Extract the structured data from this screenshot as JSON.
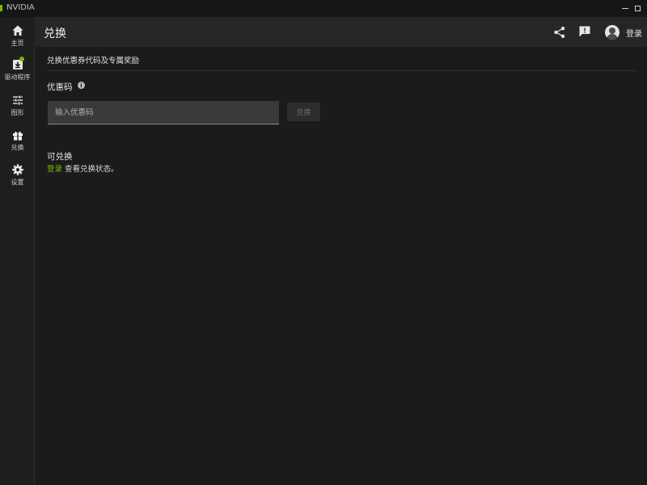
{
  "window": {
    "title": "NVIDIA"
  },
  "sidebar": {
    "items": [
      {
        "label": "主页",
        "icon": "home-icon"
      },
      {
        "label": "驱动程序",
        "icon": "download-icon",
        "badge": true
      },
      {
        "label": "图形",
        "icon": "sliders-icon"
      },
      {
        "label": "兑换",
        "icon": "gift-icon",
        "active": true
      },
      {
        "label": "设置",
        "icon": "gear-icon"
      }
    ]
  },
  "header": {
    "title": "兑换",
    "share_icon": "share-icon",
    "feedback_icon": "feedback-icon",
    "login_label": "登录"
  },
  "main": {
    "subtitle": "兑换优惠券代码及专属奖励",
    "code_section": {
      "label": "优惠码",
      "info_glyph": "i",
      "input_value": "",
      "input_placeholder": "输入优惠码",
      "button_label": "兑换"
    },
    "redeemable": {
      "title": "可兑换",
      "login_link": "登录",
      "status_text": " 查看兑换状态。"
    }
  },
  "colors": {
    "accent": "#76b900",
    "background": "#1b1b1b",
    "sidebar": "#1e1e1e",
    "header": "#262626",
    "input": "#3a3a3a"
  }
}
